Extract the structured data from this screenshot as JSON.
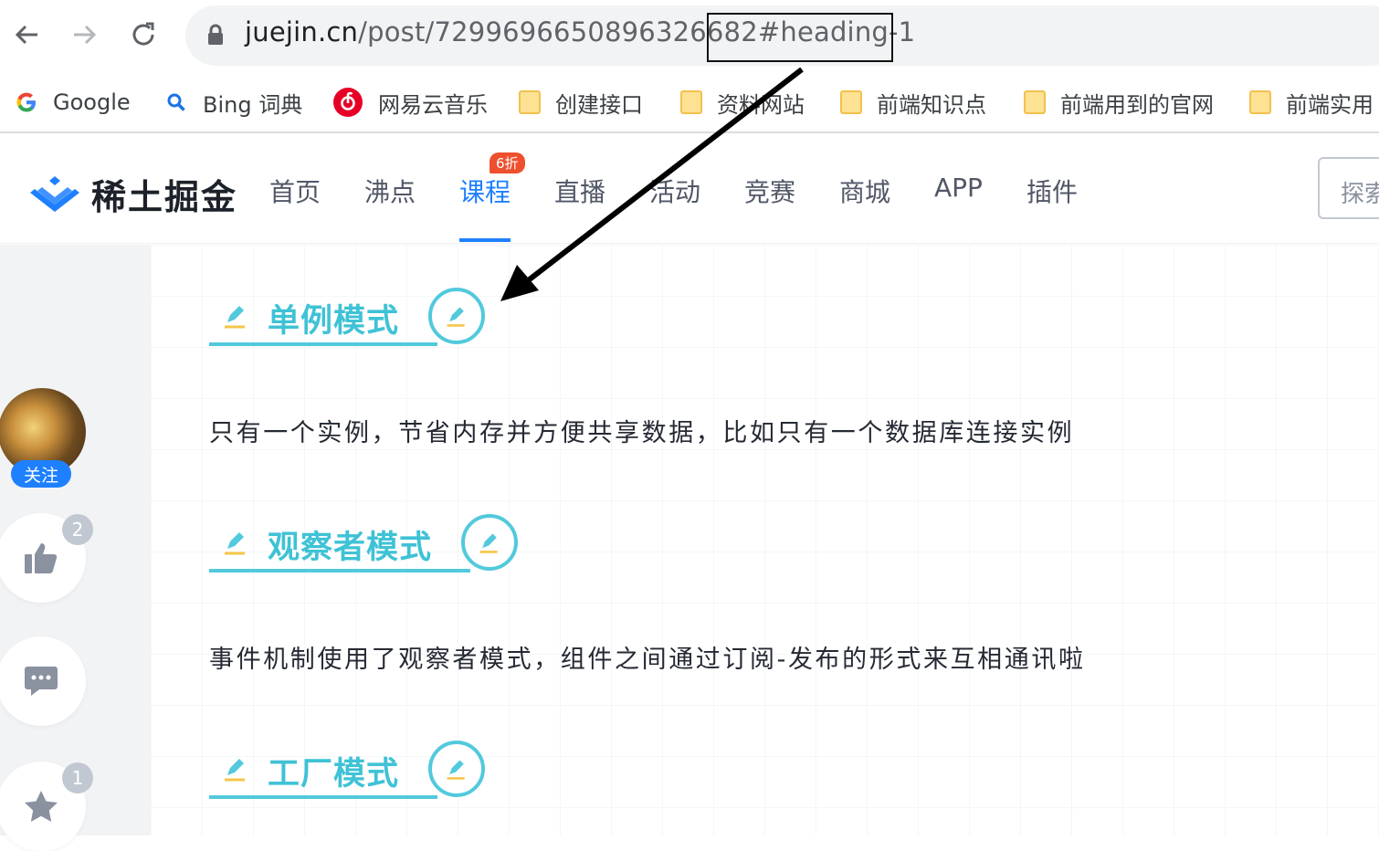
{
  "browser": {
    "url_host": "juejin.cn",
    "url_path": "/post/7299696650896326682",
    "url_hash": "#heading-1",
    "bookmarks": [
      {
        "label": "Google",
        "icon": "google-icon"
      },
      {
        "label": "Bing 词典",
        "icon": "bing-search-icon"
      },
      {
        "label": "网易云音乐",
        "icon": "netease-music-icon"
      },
      {
        "label": "创建接口",
        "icon": "folder-icon"
      },
      {
        "label": "资料网站",
        "icon": "folder-icon"
      },
      {
        "label": "前端知识点",
        "icon": "folder-icon"
      },
      {
        "label": "前端用到的官网",
        "icon": "folder-icon"
      },
      {
        "label": "前端实用",
        "icon": "folder-icon"
      }
    ]
  },
  "header": {
    "logo_text": "稀土掘金",
    "nav": [
      "首页",
      "沸点",
      "课程",
      "直播",
      "活动",
      "竞赛",
      "商城",
      "APP",
      "插件"
    ],
    "active_nav": "课程",
    "course_badge": "6折",
    "search_placeholder": "探索"
  },
  "sidebar": {
    "follow_label": "关注",
    "like_count": "2",
    "collect_count": "1"
  },
  "article": {
    "headings": [
      "单例模式",
      "观察者模式",
      "工厂模式"
    ],
    "paragraphs": [
      "只有一个实例，节省内存并方便共享数据，比如只有一个数据库连接实例",
      "事件机制使用了观察者模式，组件之间通过订阅-发布的形式来互相通讯啦"
    ]
  },
  "colors": {
    "brand": "#1e80ff",
    "heading": "#3fc2d6",
    "badge": "#ee502f"
  }
}
